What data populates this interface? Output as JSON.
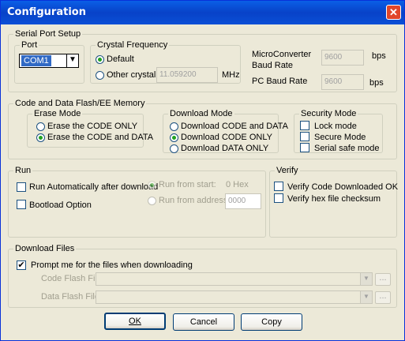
{
  "window": {
    "title": "Configuration"
  },
  "serial_port": {
    "legend": "Serial Port Setup",
    "port_legend": "Port",
    "port_value": "COM1",
    "crystal_legend": "Crystal Frequency",
    "default_label": "Default",
    "other_label": "Other crystal",
    "crystal_value": "11.059200",
    "mhz": "MHz",
    "mc_baud_label_1": "MicroConverter",
    "mc_baud_label_2": "Baud Rate",
    "mc_baud_value": "9600",
    "mc_baud_unit": "bps",
    "pc_baud_label": "PC Baud Rate",
    "pc_baud_value": "9600",
    "pc_baud_unit": "bps"
  },
  "memory": {
    "legend": "Code and Data Flash/EE Memory",
    "erase_legend": "Erase Mode",
    "erase_options": [
      "Erase the CODE ONLY",
      "Erase the CODE and DATA"
    ],
    "download_legend": "Download Mode",
    "download_options": [
      "Download CODE and DATA",
      "Download CODE ONLY",
      "Download DATA ONLY"
    ],
    "security_legend": "Security Mode",
    "security_options": [
      "Lock mode",
      "Secure Mode",
      "Serial safe mode"
    ]
  },
  "run": {
    "legend": "Run",
    "auto_run_label": "Run Automatically after download",
    "bootload_label": "Bootload Option",
    "from_start_label": "Run from start:",
    "from_start_value": "0 Hex",
    "from_address_label": "Run from address:",
    "from_address_value": "0000"
  },
  "verify": {
    "legend": "Verify",
    "verify_code_label": "Verify Code Downloaded OK",
    "verify_hex_label": "Verify hex file checksum"
  },
  "download_files": {
    "legend": "Download Files",
    "prompt_label": "Prompt me for the files when downloading",
    "code_flash_label": "Code Flash File",
    "data_flash_label": "Data Flash File",
    "browse_label": "..."
  },
  "buttons": {
    "ok": "OK",
    "cancel": "Cancel",
    "copy": "Copy"
  }
}
